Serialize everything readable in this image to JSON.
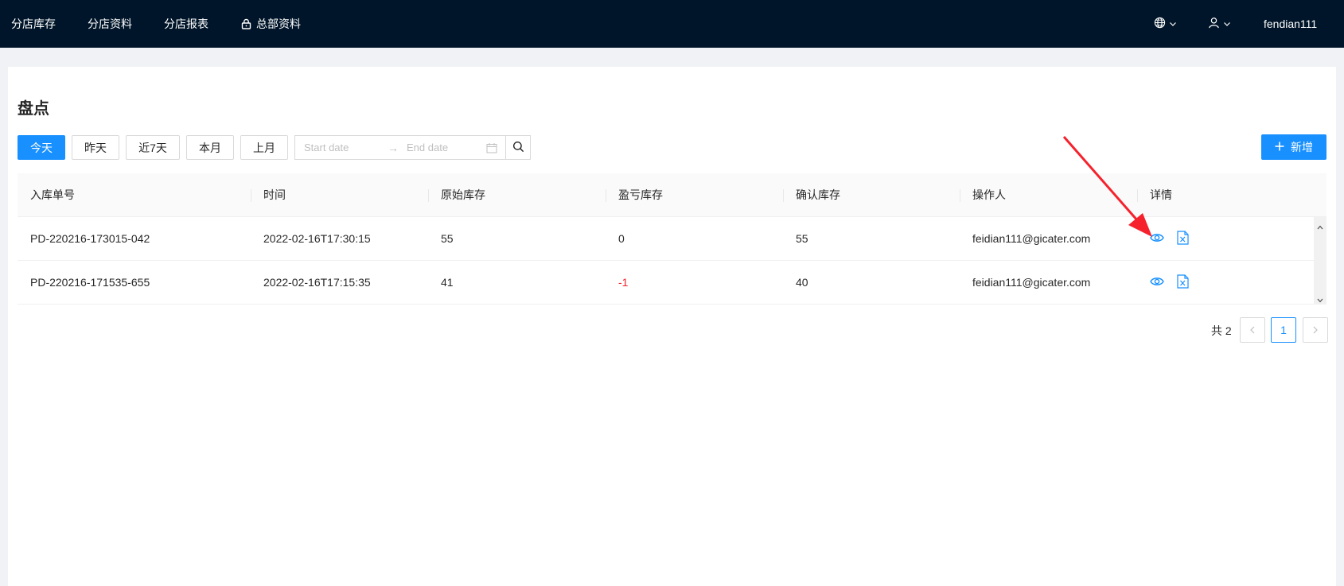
{
  "topbar": {
    "nav": [
      {
        "label": "分店库存",
        "icon": ""
      },
      {
        "label": "分店资料",
        "icon": ""
      },
      {
        "label": "分店报表",
        "icon": ""
      },
      {
        "label": "总部资料",
        "icon": "lock-icon"
      }
    ],
    "language_icon": "globe-icon",
    "user_icon": "user-icon",
    "username": "fendian111"
  },
  "page": {
    "title": "盘点"
  },
  "filters": {
    "quick": [
      "今天",
      "昨天",
      "近7天",
      "本月",
      "上月"
    ],
    "active_index": 0,
    "start_placeholder": "Start date",
    "end_placeholder": "End date",
    "separator": "→"
  },
  "add_button": {
    "label": "新增"
  },
  "table": {
    "columns": [
      "入库单号",
      "时间",
      "原始库存",
      "盈亏库存",
      "确认库存",
      "操作人",
      "详情"
    ],
    "rows": [
      {
        "id": "PD-220216-173015-042",
        "time": "2022-02-16T17:30:15",
        "original": "55",
        "diff": "0",
        "confirmed": "55",
        "operator": "feidian111@gicater.com"
      },
      {
        "id": "PD-220216-171535-655",
        "time": "2022-02-16T17:15:35",
        "original": "41",
        "diff": "-1",
        "confirmed": "40",
        "operator": "feidian111@gicater.com"
      }
    ]
  },
  "pagination": {
    "total_label": "共 2",
    "current_page": "1"
  },
  "colors": {
    "primary": "#1890ff",
    "header_bg": "#001529",
    "negative": "#f5222d",
    "annotation": "#f5222d"
  }
}
